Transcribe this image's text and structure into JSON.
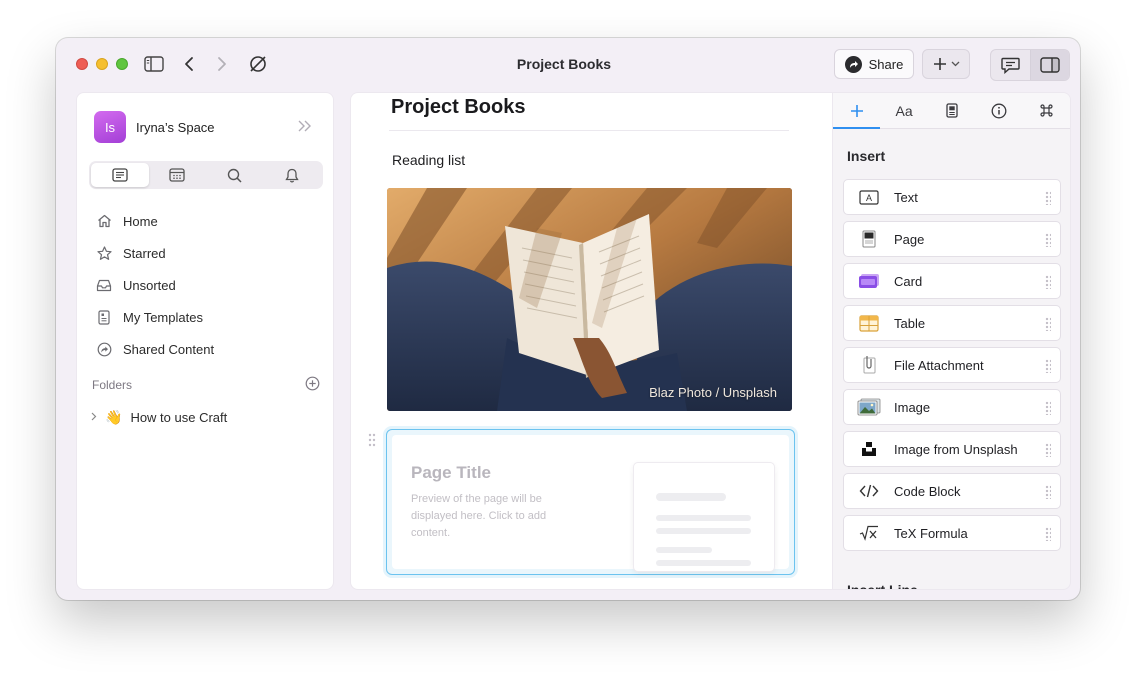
{
  "window": {
    "title": "Project Books"
  },
  "toolbar": {
    "share_label": "Share"
  },
  "sidebar": {
    "space_initials": "Is",
    "space_name": "Iryna’s Space",
    "nav": [
      {
        "label": "Home",
        "icon": "home-icon"
      },
      {
        "label": "Starred",
        "icon": "star-icon"
      },
      {
        "label": "Unsorted",
        "icon": "inbox-icon"
      },
      {
        "label": "My Templates",
        "icon": "template-icon"
      },
      {
        "label": "Shared Content",
        "icon": "shared-icon"
      }
    ],
    "folders_label": "Folders",
    "folder": {
      "emoji": "👋",
      "label": "How to use Craft"
    }
  },
  "document": {
    "title": "Project Books",
    "subtitle": "Reading list",
    "photo_credit": "Blaz Photo / Unsplash",
    "card": {
      "title": "Page Title",
      "description": "Preview of the page will be displayed here. Click to add content."
    }
  },
  "panel": {
    "tabs": [
      "+",
      "Aa",
      "style-icon",
      "info-icon",
      "command-icon"
    ],
    "aa_label": "Aa",
    "heading": "Insert",
    "items": [
      {
        "label": "Text",
        "icon": "text-icon"
      },
      {
        "label": "Page",
        "icon": "page-icon"
      },
      {
        "label": "Card",
        "icon": "card-icon"
      },
      {
        "label": "Table",
        "icon": "table-icon"
      },
      {
        "label": "File Attachment",
        "icon": "attachment-icon"
      },
      {
        "label": "Image",
        "icon": "image-icon"
      },
      {
        "label": "Image from Unsplash",
        "icon": "unsplash-icon"
      },
      {
        "label": "Code Block",
        "icon": "code-icon"
      },
      {
        "label": "TeX Formula",
        "icon": "formula-icon"
      }
    ],
    "heading2": "Insert Line"
  },
  "colors": {
    "accent": "#2f8ff0",
    "selection": "#6cc3ef",
    "avatar": "#b84ee0"
  }
}
